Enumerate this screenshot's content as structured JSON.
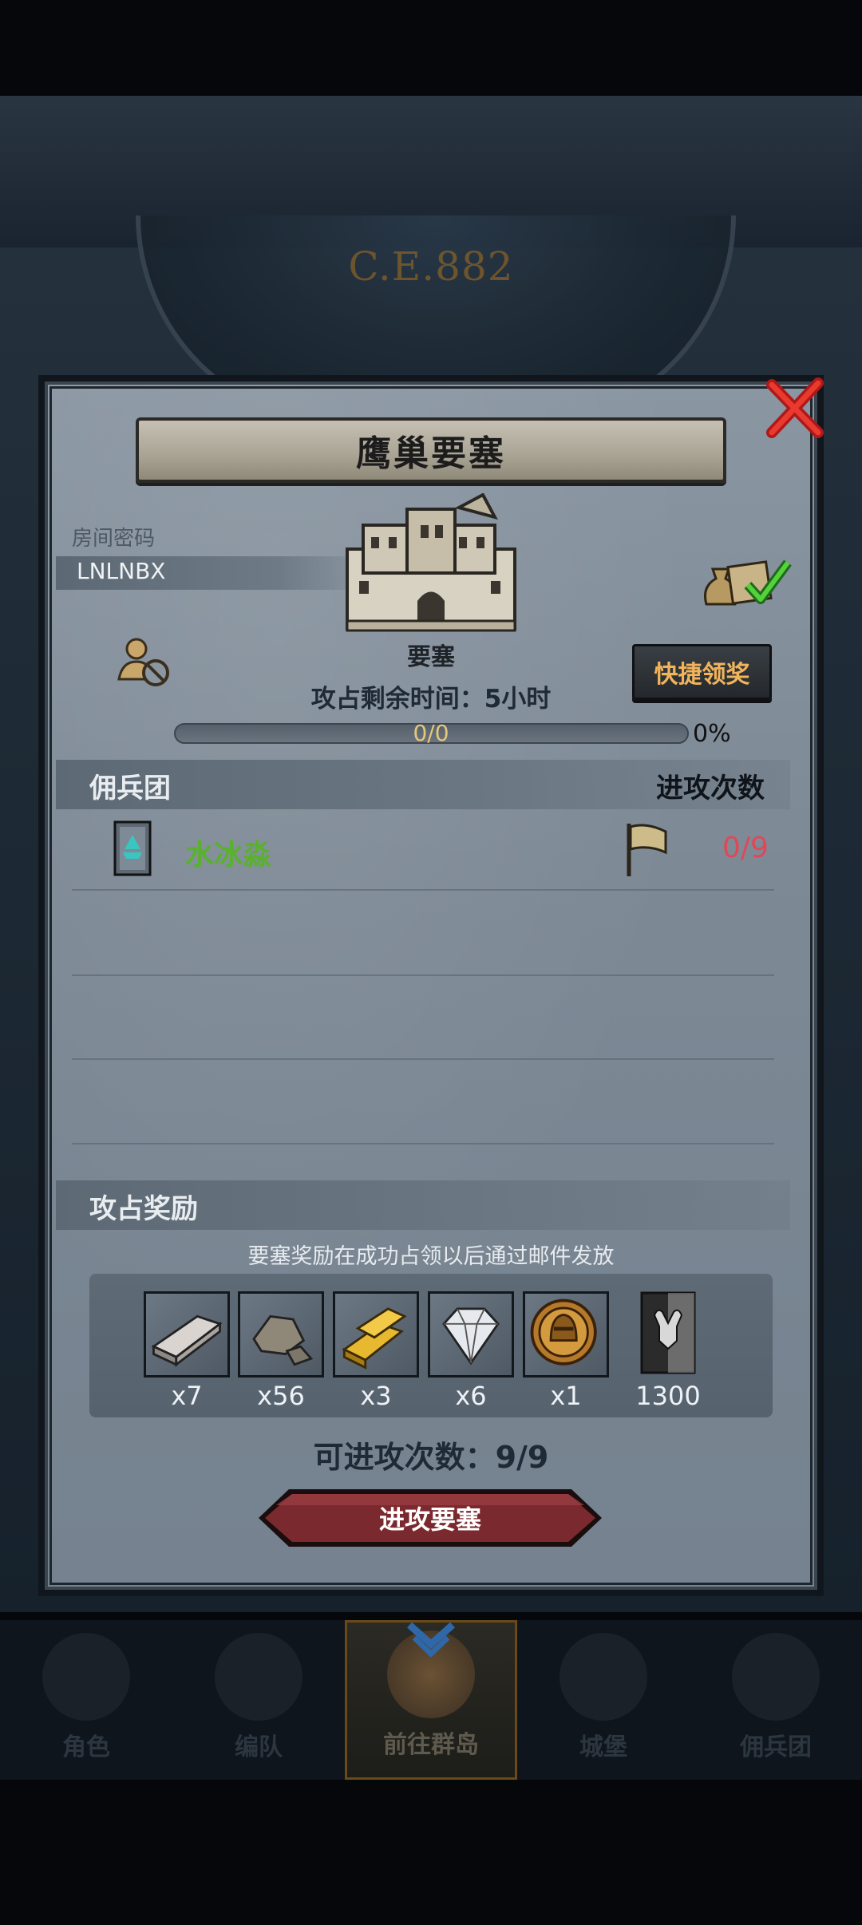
{
  "background": {
    "year_text": "C.E.882"
  },
  "dialog": {
    "title": "鹰巢要塞",
    "room_password_label": "房间密码",
    "room_password": "LNLNBX",
    "fortress_label": "要塞",
    "quick_claim_label": "快捷领奖",
    "timer_text": "攻占剩余时间：5小时",
    "progress": {
      "text": "0/0",
      "percent_text": "0%",
      "fraction": 0
    },
    "guild_section": {
      "left": "佣兵团",
      "right": "进攻次数"
    },
    "guild_rows": [
      {
        "name": "水冰淼",
        "attacks": "0/9"
      }
    ],
    "reward_section": {
      "title": "攻占奖励",
      "note": "要塞奖励在成功占领以后通过邮件发放",
      "items": [
        {
          "icon": "silver-ingot-icon",
          "qty": "x7"
        },
        {
          "icon": "stone-ore-icon",
          "qty": "x56"
        },
        {
          "icon": "gold-bars-icon",
          "qty": "x3"
        },
        {
          "icon": "diamond-icon",
          "qty": "x6"
        },
        {
          "icon": "knight-helmet-coin-icon",
          "qty": "x1"
        },
        {
          "icon": "bull-banner-icon",
          "qty": "1300"
        }
      ]
    },
    "attacks_left_text": "可进攻次数：9/9",
    "attack_button_label": "进攻要塞"
  },
  "nav": {
    "items": [
      {
        "label": "角色",
        "icon": "knight-icon"
      },
      {
        "label": "编队",
        "icon": "helmet-icon"
      },
      {
        "label": "前往群岛",
        "icon": "globe-icon"
      },
      {
        "label": "城堡",
        "icon": "castle-icon"
      },
      {
        "label": "佣兵团",
        "icon": "mercenary-icon"
      }
    ]
  },
  "colors": {
    "guild_name": "#5ab02f",
    "attack_count": "#e04858",
    "quick_claim_text": "#f2b45a",
    "attack_button": "#7a2a2e"
  }
}
